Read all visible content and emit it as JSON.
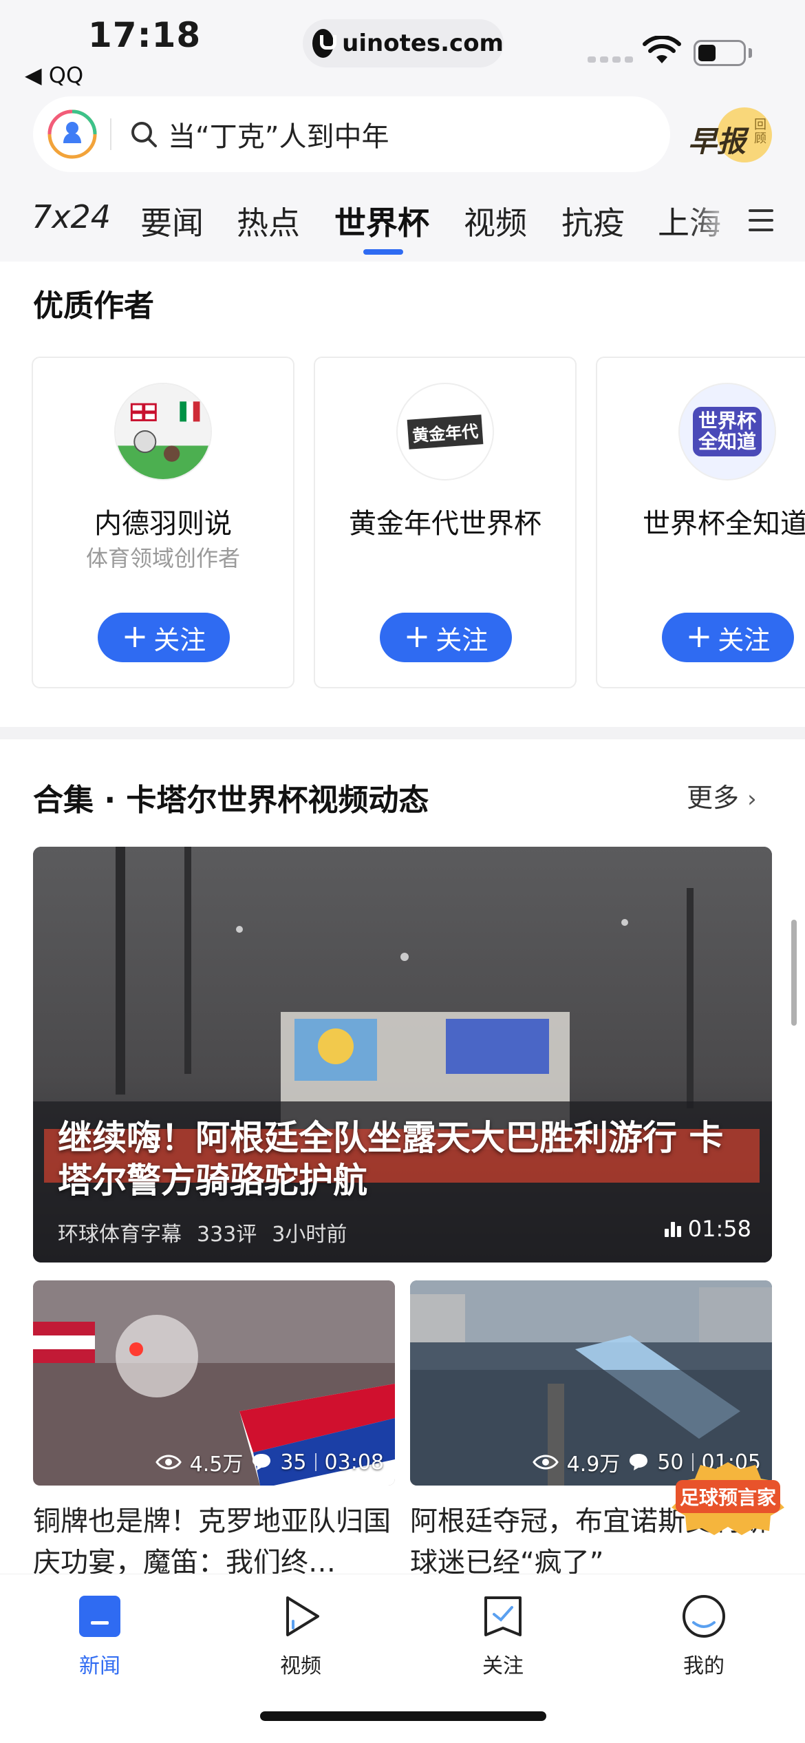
{
  "status_bar": {
    "time": "17:18",
    "back_app": "◀ QQ",
    "url": "uinotes.com"
  },
  "search": {
    "query": "当“丁克”人到中年",
    "morning_report": "早报",
    "morning_report_sub": "回顾"
  },
  "tabs": [
    "7x24",
    "要闻",
    "热点",
    "世界杯",
    "视频",
    "抗疫",
    "上海"
  ],
  "active_tab": "世界杯",
  "authors": {
    "title": "优质作者",
    "follow_label": "关注",
    "items": [
      {
        "name": "内德羽则说",
        "desc": "体育领域创作者"
      },
      {
        "name": "黄金年代世界杯",
        "desc": "",
        "avatar_text": "黄金年代"
      },
      {
        "name": "世界杯全知道",
        "desc": "",
        "avatar_text": "世界杯全知道"
      }
    ]
  },
  "collection": {
    "title": "合集 · 卡塔尔世界杯视频动态",
    "more": "更多",
    "hero": {
      "title": "继续嗨！阿根廷全队坐露天大巴胜利游行 卡塔尔警方骑骆驼护航",
      "source": "环球体育字幕",
      "comments": "333评",
      "time_ago": "3小时前",
      "duration": "01:58"
    },
    "thumbs": [
      {
        "views": "4.5万",
        "comments": "35",
        "duration": "03:08",
        "caption": "铜牌也是牌！克罗地亚队归国庆功宴，魔笛：我们终…"
      },
      {
        "views": "4.9万",
        "comments": "50",
        "duration": "01:05",
        "caption": "阿根廷夺冠，布宜诺斯艾利斯球迷已经“疯了”"
      }
    ],
    "badge": "足球预言家"
  },
  "bottom_nav": [
    {
      "label": "新闻",
      "icon": "news-icon",
      "active": true
    },
    {
      "label": "视频",
      "icon": "video-play-icon",
      "active": false
    },
    {
      "label": "关注",
      "icon": "follow-check-icon",
      "active": false
    },
    {
      "label": "我的",
      "icon": "profile-icon",
      "active": false
    }
  ],
  "colors": {
    "accent": "#2f6bf2",
    "header_bg": "#f6f6f8"
  }
}
